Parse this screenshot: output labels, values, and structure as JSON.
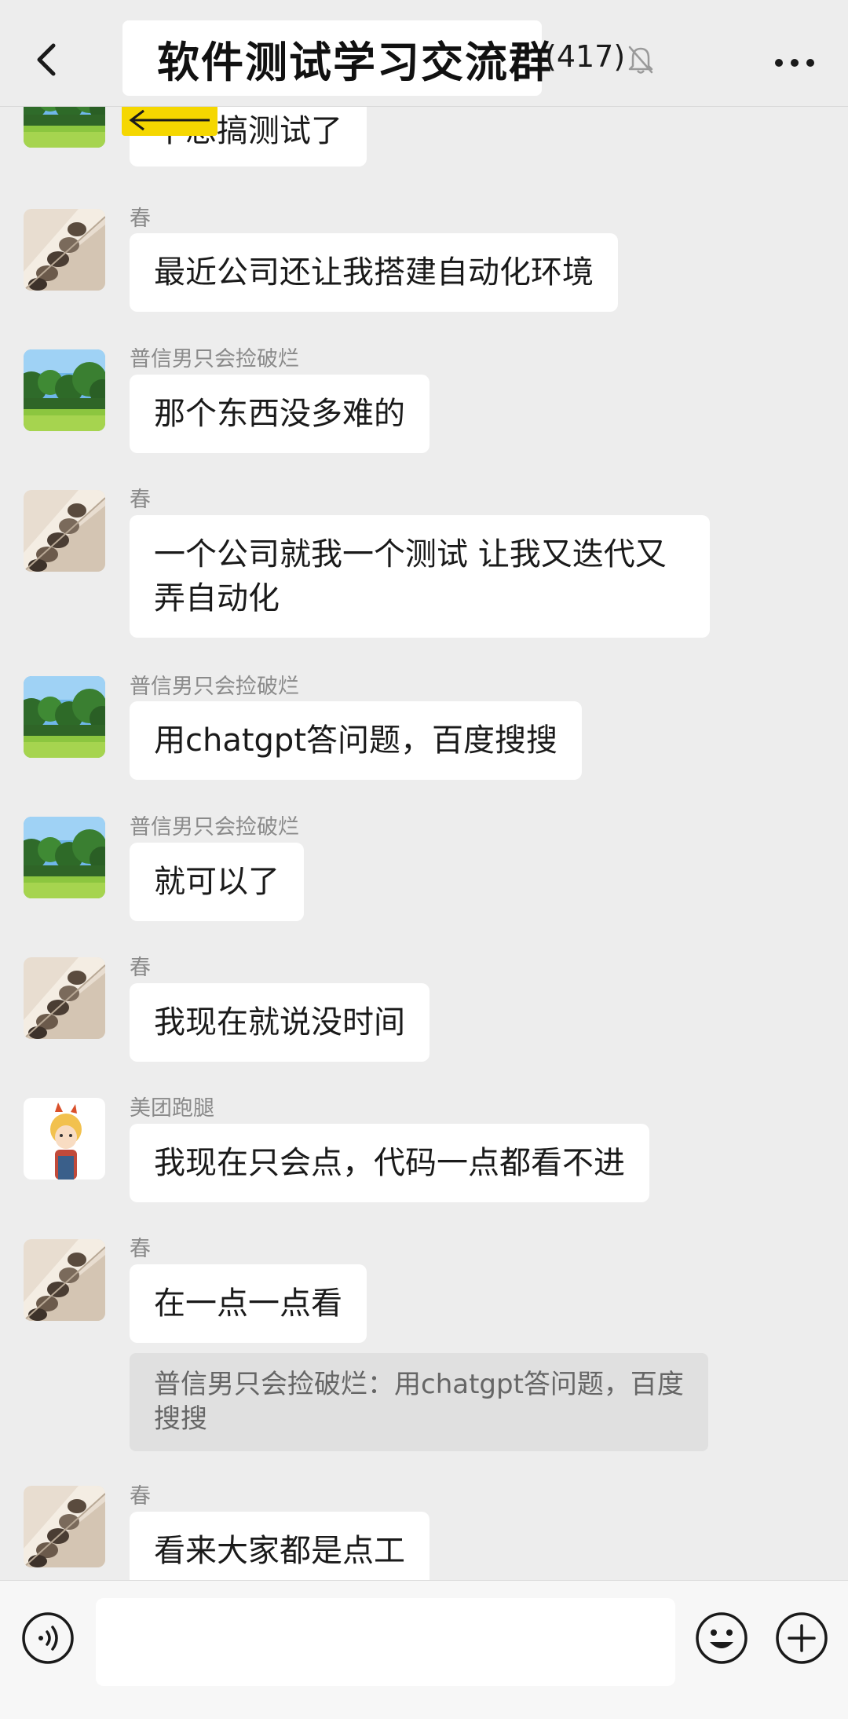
{
  "header": {
    "title": "软件测试学习交流群",
    "member_count": "(417)"
  },
  "messages": [
    {
      "sender": "",
      "text": "不想搞测试了",
      "avatar": "forest"
    },
    {
      "sender": "春",
      "text": "最近公司还让我搭建自动化环境",
      "avatar": "ornament"
    },
    {
      "sender": "普信男只会捡破烂",
      "text": "那个东西没多难的",
      "avatar": "forest"
    },
    {
      "sender": "春",
      "text": "一个公司就我一个测试 让我又迭代又弄自动化",
      "avatar": "ornament"
    },
    {
      "sender": "普信男只会捡破烂",
      "text": "用chatgpt答问题，百度搜搜",
      "avatar": "forest"
    },
    {
      "sender": "普信男只会捡破烂",
      "text": "就可以了",
      "avatar": "forest"
    },
    {
      "sender": "春",
      "text": "我现在就说没时间",
      "avatar": "ornament"
    },
    {
      "sender": "美团跑腿",
      "text": "我现在只会点，代码一点都看不进",
      "avatar": "cartoon"
    },
    {
      "sender": "春",
      "text": "在一点一点看",
      "avatar": "ornament"
    },
    {
      "sender": "春",
      "text": "看来大家都是点工",
      "avatar": "ornament"
    }
  ],
  "quote": {
    "text": "普信男只会捡破烂：用chatgpt答问题，百度搜搜"
  },
  "input": {
    "value": ""
  },
  "icons": {
    "back": "chevron-left-icon",
    "mute": "bell-muted-icon",
    "more": "more-dots-icon",
    "voice": "voice-icon",
    "emoji": "emoji-icon",
    "plus": "plus-icon"
  },
  "colors": {
    "background": "#ededed",
    "bubble": "#ffffff",
    "quote": "#e0e0e0",
    "annotation": "#f5d700"
  }
}
